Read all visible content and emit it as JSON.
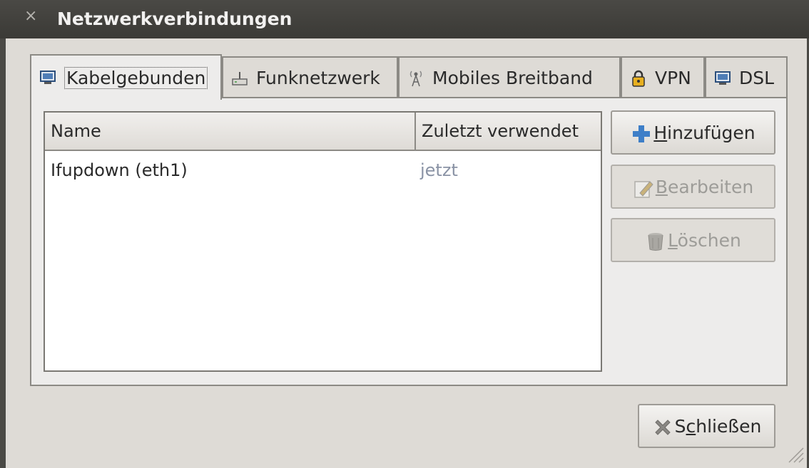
{
  "window": {
    "title": "Netzwerkverbindungen",
    "close_glyph": "×"
  },
  "tabs": [
    {
      "label": "Kabelgebunden",
      "icon": "wired-network-icon",
      "active": true
    },
    {
      "label": "Funknetzwerk",
      "icon": "wireless-router-icon",
      "active": false
    },
    {
      "label": "Mobiles Breitband",
      "icon": "antenna-icon",
      "active": false
    },
    {
      "label": "VPN",
      "icon": "lock-icon",
      "active": false
    },
    {
      "label": "DSL",
      "icon": "dsl-network-icon",
      "active": false
    }
  ],
  "table": {
    "columns": [
      "Name",
      "Zuletzt verwendet"
    ],
    "rows": [
      {
        "name": "Ifupdown (eth1)",
        "last_used": "jetzt"
      }
    ]
  },
  "buttons": {
    "add": {
      "mnemonic": "H",
      "rest": "inzufügen",
      "enabled": true
    },
    "edit": {
      "mnemonic": "B",
      "rest": "earbeiten",
      "enabled": false
    },
    "delete": {
      "mnemonic": "L",
      "rest": "öschen",
      "enabled": false
    },
    "close": {
      "pre": "S",
      "mnemonic": "c",
      "rest": "hließen",
      "enabled": true
    }
  },
  "colors": {
    "accent_add": "#3e7fc8",
    "last_used_text": "#8a93a5"
  }
}
